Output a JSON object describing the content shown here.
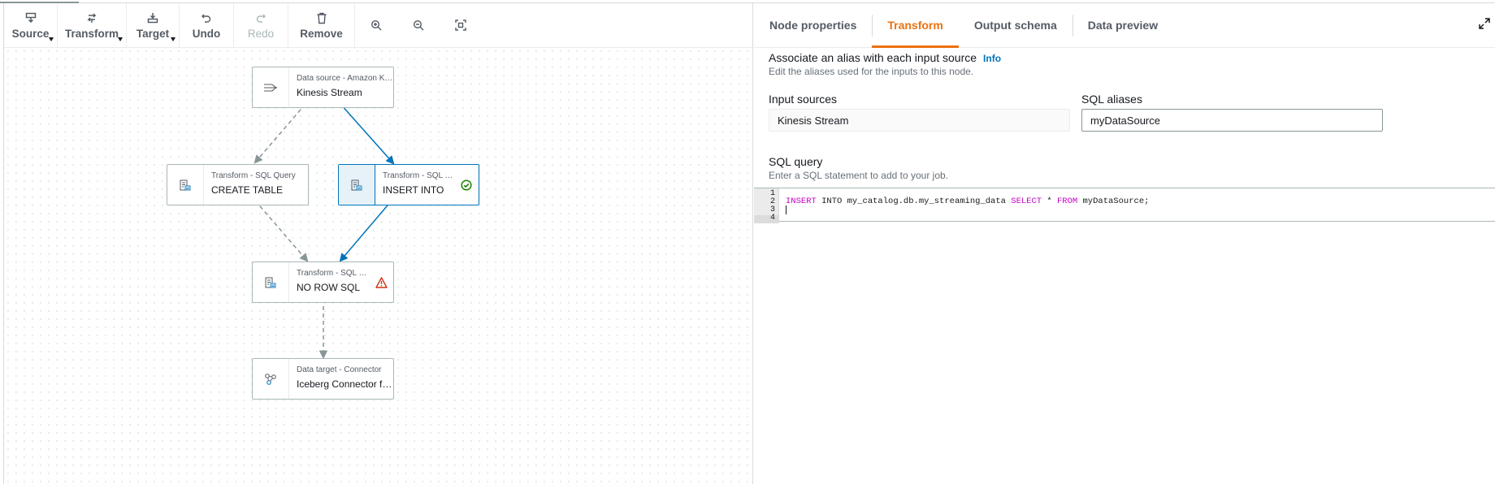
{
  "toolbar": {
    "source_label": "Source",
    "transform_label": "Transform",
    "target_label": "Target",
    "undo_label": "Undo",
    "redo_label": "Redo",
    "remove_label": "Remove",
    "zoom_in_icon": "zoom-in-icon",
    "zoom_out_icon": "zoom-out-icon",
    "fit_icon": "fit-to-screen-icon"
  },
  "nodes": {
    "kinesis": {
      "type": "Data source - Amazon Kin...",
      "name": "Kinesis Stream",
      "icon": "stream-icon"
    },
    "create_table": {
      "type": "Transform - SQL Query",
      "name": "CREATE TABLE",
      "icon": "sql-query-icon"
    },
    "insert_into": {
      "type": "Transform - SQL Query",
      "name": "INSERT INTO",
      "icon": "sql-query-icon",
      "status": "success-check-icon"
    },
    "no_row_sql": {
      "type": "Transform - SQL Query",
      "name": "NO ROW SQL",
      "icon": "sql-query-icon",
      "status": "warning-icon"
    },
    "iceberg": {
      "type": "Data target - Connector",
      "name": "Iceberg Connector fo...",
      "icon": "connector-icon"
    }
  },
  "panel": {
    "tabs": [
      "Node properties",
      "Transform",
      "Output schema",
      "Data preview"
    ],
    "active_tab": "Transform",
    "alias_title": "Associate an alias with each input source",
    "info_link": "Info",
    "alias_desc": "Edit the aliases used for the inputs to this node.",
    "input_sources_label": "Input sources",
    "input_sources_value": "Kinesis Stream",
    "sql_aliases_label": "SQL aliases",
    "sql_aliases_value": "myDataSource",
    "sql_query_title": "SQL query",
    "sql_query_desc": "Enter a SQL statement to add to your job.",
    "editor": {
      "line_numbers": [
        "1",
        "2",
        "3",
        "4"
      ],
      "line2": {
        "kw1": "INSERT",
        "t1": " INTO my_catalog.db.my_streaming_data ",
        "kw2": "SELECT",
        "t2": " * ",
        "kw3": "FROM",
        "t3": " myDataSource;"
      }
    }
  },
  "colors": {
    "accent_orange": "#ec7211",
    "selected_blue": "#0073bb",
    "edge_gray": "#879596",
    "keyword_magenta": "#c500c5",
    "warning_red": "#d13212",
    "success_green": "#1d8102"
  }
}
